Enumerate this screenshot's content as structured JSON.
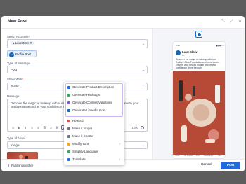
{
  "modal": {
    "title": "New Post"
  },
  "header_icons": [
    "compress-icon",
    "expand-icon",
    "close-icon"
  ],
  "form": {
    "accounts_label": "Select Accounts",
    "accounts_tag": "LuxeGlow",
    "profile_chip": "Profile Post",
    "type_label": "Type of Message",
    "type_value": "Post",
    "share_label": "Share With",
    "share_value": "Public",
    "message_label": "Message",
    "message_text": "Discover the magic of makeup with our Radiant Glow Foundation and Luxe lashes. Elevate your beauty routine and let your confidence shine through!",
    "char_count": "1000",
    "asset_label": "Type of Asset",
    "asset_value": "Image"
  },
  "ai_menu": {
    "group": [
      "Generate Product Description",
      "Generate Hashtags",
      "Generate Content Variations",
      "Generate LinkedIn Post"
    ],
    "items": [
      "Reword",
      "Make it longer",
      "Make it Shorter",
      "Modify Tone",
      "Simplify Language",
      "Translate"
    ]
  },
  "footer": {
    "publish_another": "Publish another",
    "cancel": "Cancel",
    "post": "Post"
  },
  "preview": {
    "time": "9:41",
    "name": "LuxeGlow",
    "sub": "1d",
    "text": "Discover the magic of makeup with our Radiant Glow Foundation and Luxe lashes. Elevate your beauty routine and let your confidence shine through!",
    "nav": [
      "Home",
      "My Network",
      "Post",
      "Notifications",
      "Jobs"
    ]
  },
  "colors": {
    "accent": "#1f6bde",
    "ai": "#7c5cd6",
    "image_bg": "#b74a36"
  }
}
